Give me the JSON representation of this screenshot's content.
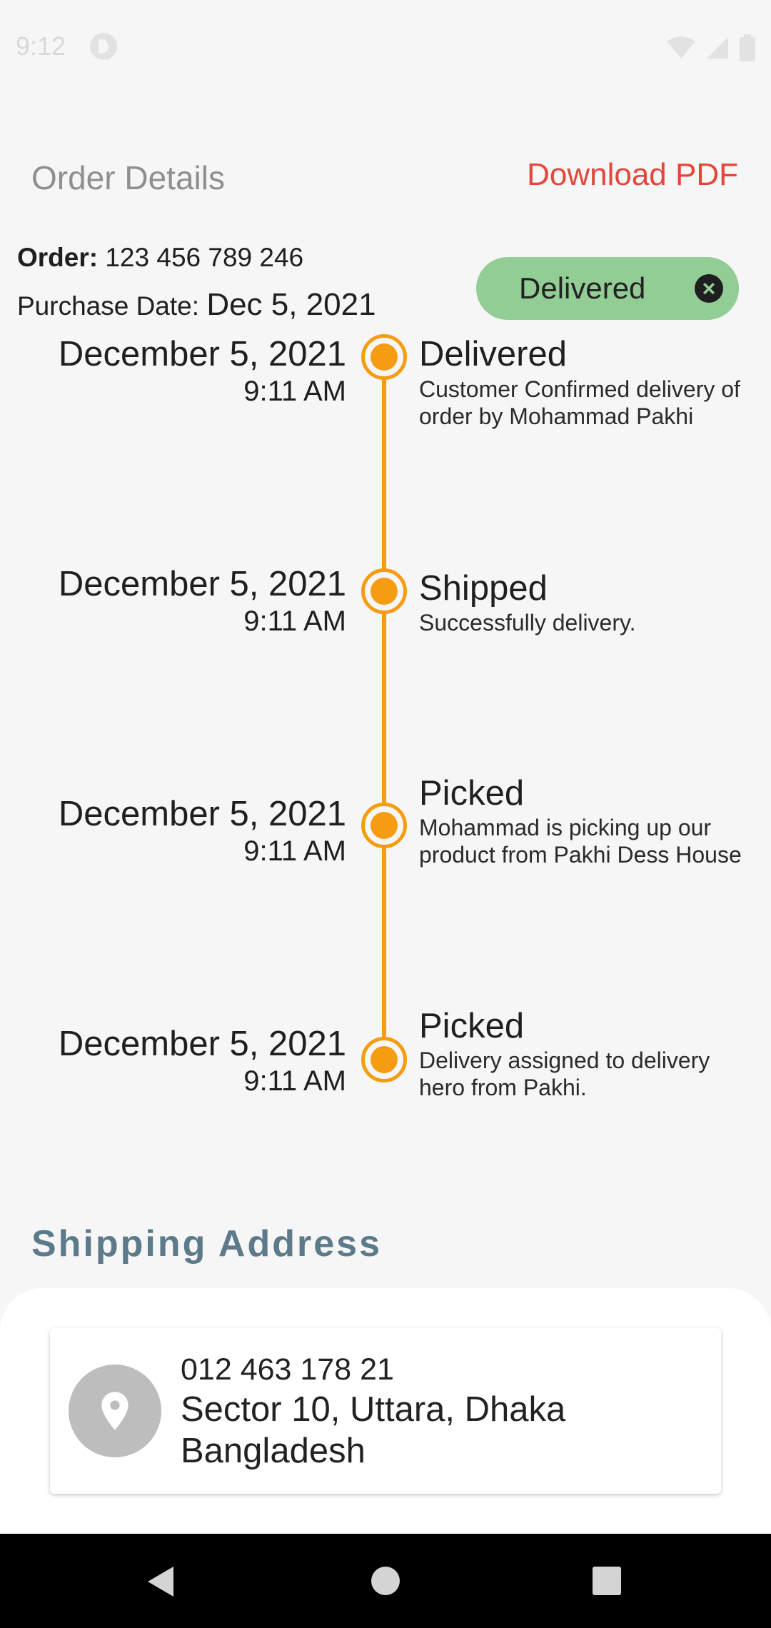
{
  "status_bar": {
    "time": "9:12"
  },
  "header": {
    "title": "Order Details",
    "download_label": "Download PDF"
  },
  "order": {
    "order_label": "Order:",
    "order_number": "123 456 789 246",
    "purchase_label": "Purchase Date:",
    "purchase_date": "Dec 5, 2021",
    "status_chip": "Delivered",
    "chip_close_icon": "close-circle-icon"
  },
  "timeline": [
    {
      "date": "December 5, 2021",
      "time": "9:11 AM",
      "title": "Delivered",
      "description": "Customer Confirmed delivery of order by Mohammad Pakhi"
    },
    {
      "date": "December 5, 2021",
      "time": "9:11 AM",
      "title": "Shipped",
      "description": "Successfully delivery."
    },
    {
      "date": "December 5, 2021",
      "time": "9:11 AM",
      "title": "Picked",
      "description": "Mohammad is picking up our product from Pakhi Dess House"
    },
    {
      "date": "December 5, 2021",
      "time": "9:11 AM",
      "title": "Picked",
      "description": "Delivery assigned to delivery hero from Pakhi."
    }
  ],
  "shipping": {
    "heading": "Shipping Address",
    "phone": "012 463 178 21",
    "address_line1": "Sector 10, Uttara, Dhaka",
    "address_line2": "Bangladesh",
    "icon": "location-pin-icon"
  },
  "colors": {
    "accent": "#f59c12",
    "link_red": "#e5463b",
    "chip_green": "#93cd96",
    "heading_slate": "#5c7a8a"
  },
  "nav": {
    "icons": [
      "back-icon",
      "home-icon",
      "recents-icon"
    ]
  }
}
